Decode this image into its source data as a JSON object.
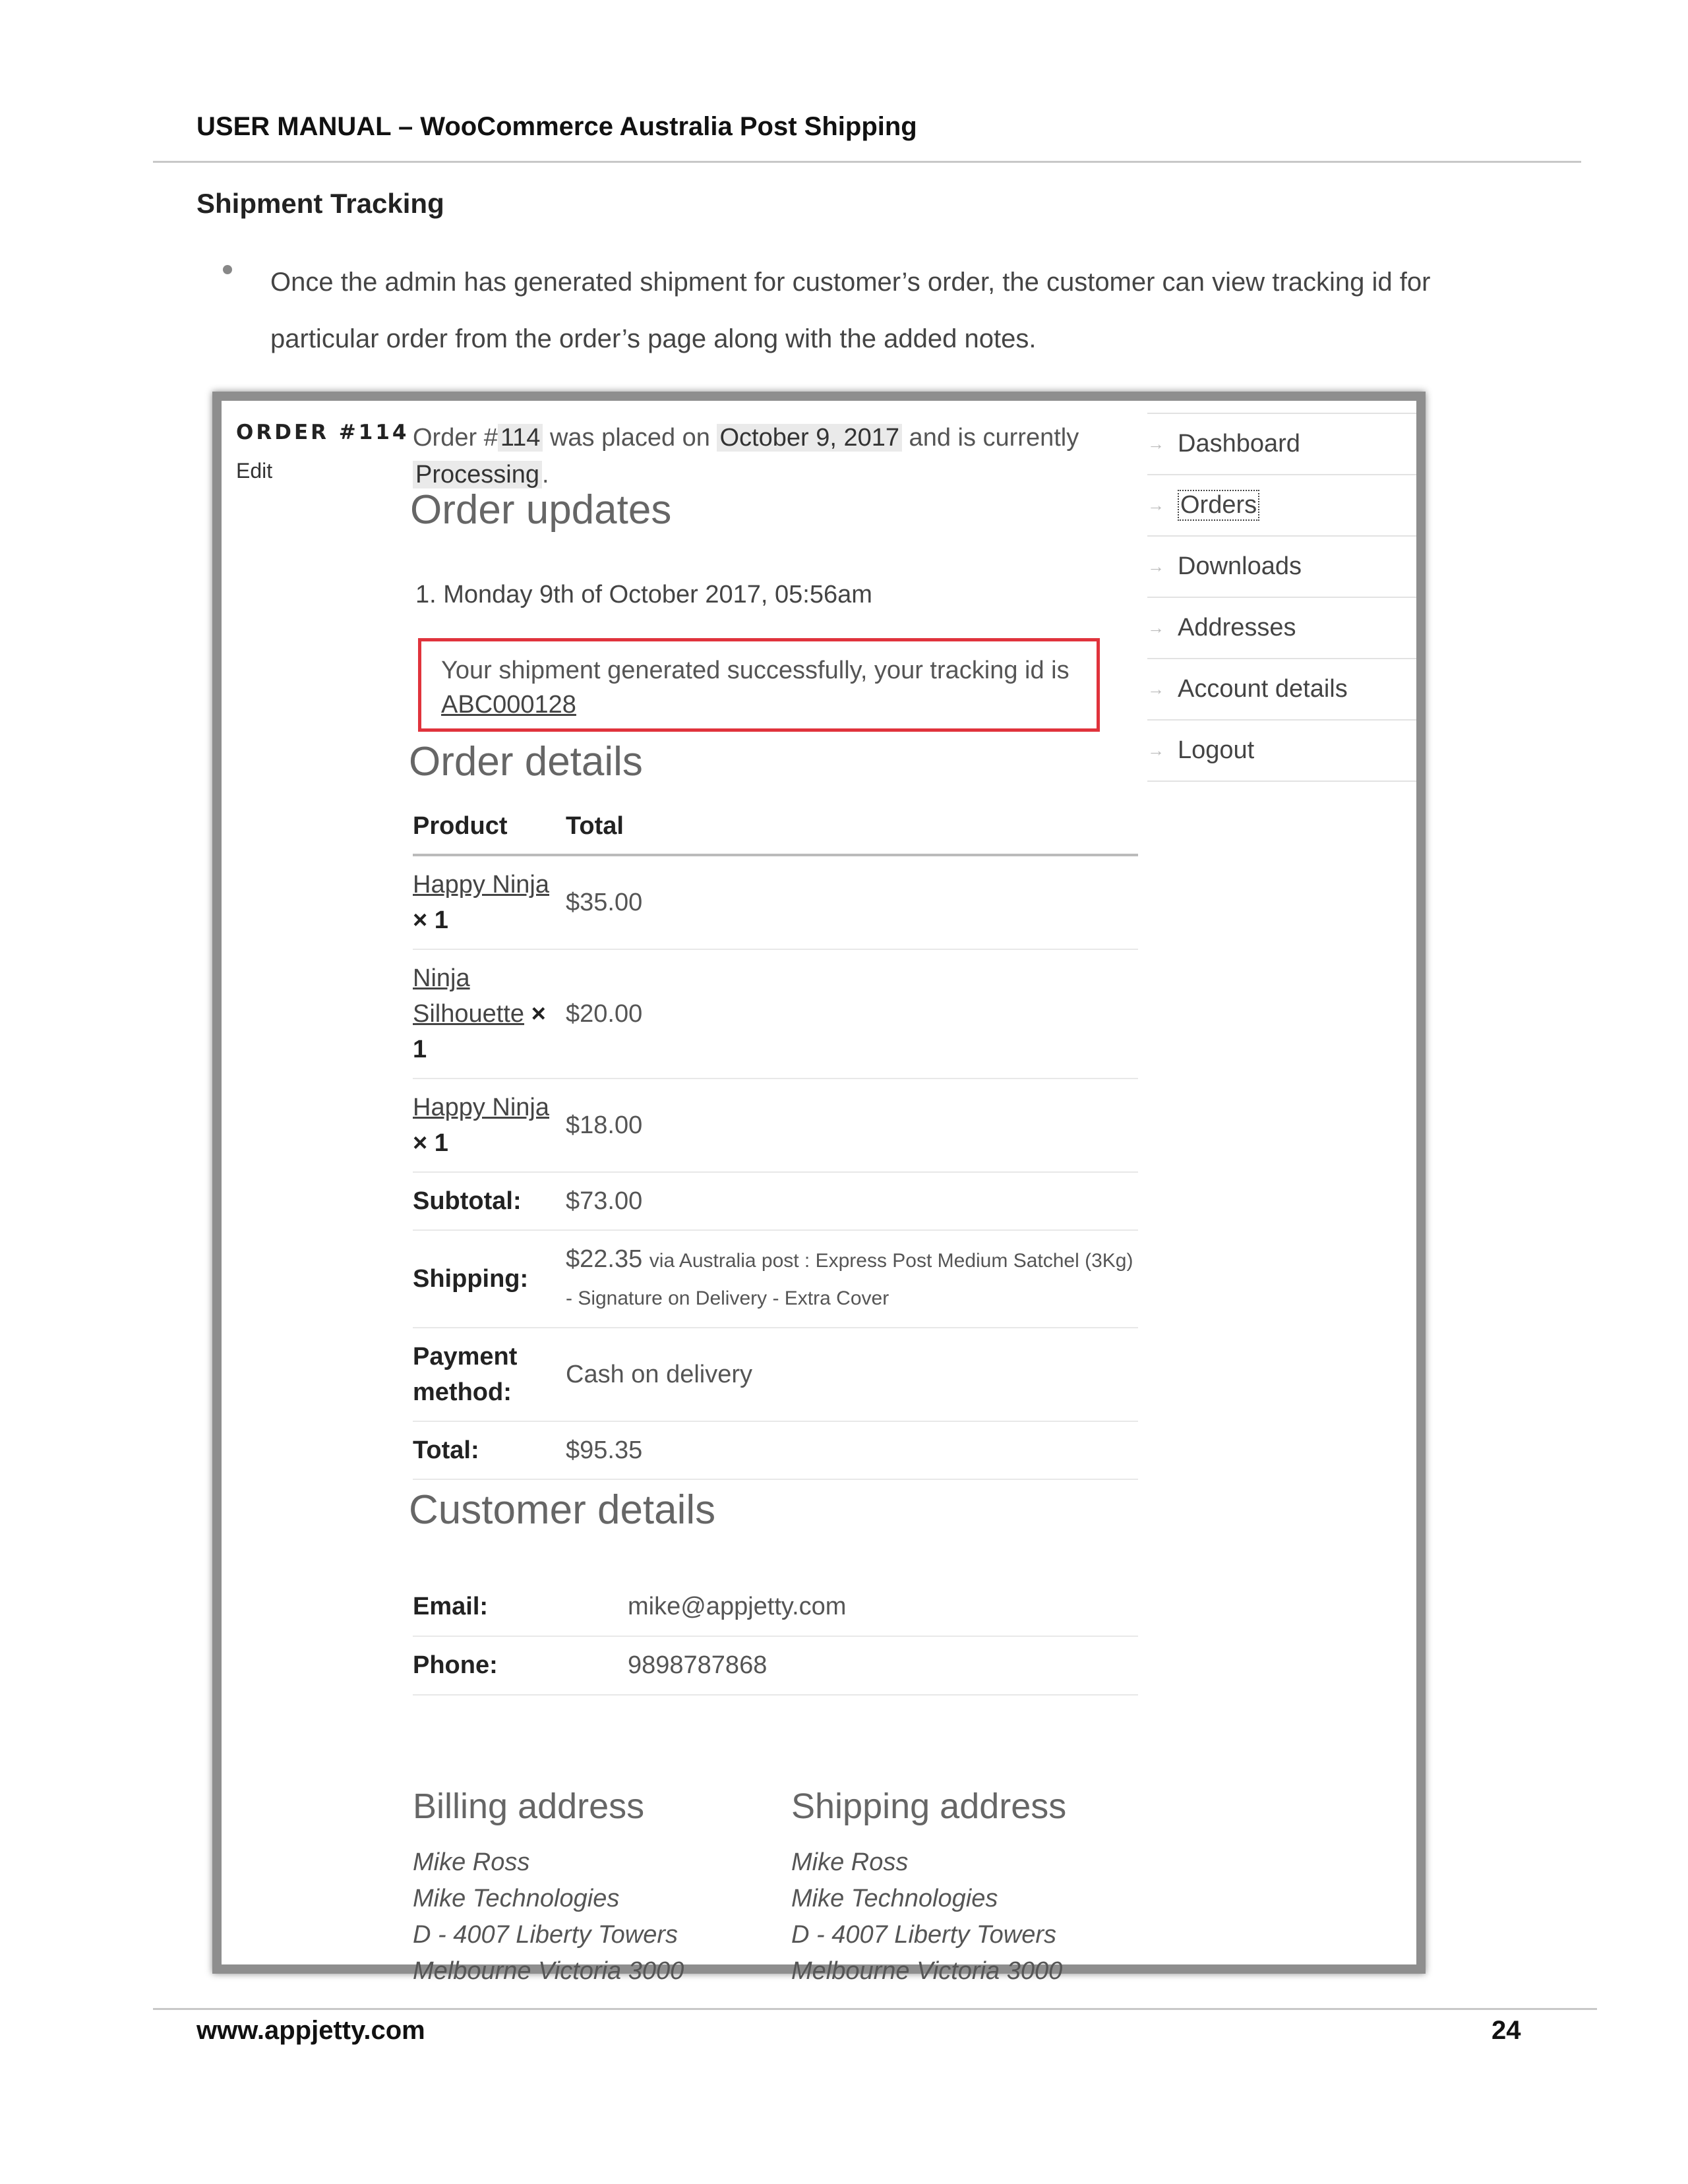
{
  "doc": {
    "header": "USER MANUAL – WooCommerce Australia Post Shipping",
    "section_title": "Shipment Tracking",
    "bullet_text": "Once the admin has generated shipment for customer’s order, the customer can view tracking id for particular order from the order’s page along with the added notes.",
    "footer_url": "www.appjetty.com",
    "page_number": "24"
  },
  "screenshot": {
    "order_label": "ORDER #114",
    "edit_label": "Edit",
    "status_line": {
      "prefix": "Order #",
      "order_number": "114",
      "mid": " was placed on ",
      "date": "October 9, 2017",
      "suffix": " and is currently ",
      "status": "Processing",
      "end": "."
    },
    "order_updates_title": "Order updates",
    "update": {
      "date": "1. Monday 9th of October 2017, 05:56am",
      "note": "Your shipment generated successfully, your tracking id is",
      "tracking_id": "ABC000128"
    },
    "order_details_title": "Order details",
    "table_headers": {
      "product": "Product",
      "total": "Total"
    },
    "products": [
      {
        "name": "Happy Ninja",
        "qty": "× 1",
        "total": "$35.00"
      },
      {
        "name": "Ninja Silhouette",
        "qty": "× 1",
        "total": "$20.00"
      },
      {
        "name": "Happy Ninja",
        "qty": "× 1",
        "total": "$18.00"
      }
    ],
    "totals": {
      "subtotal_label": "Subtotal:",
      "subtotal": "$73.00",
      "shipping_label": "Shipping:",
      "shipping_amount": "$22.35",
      "shipping_via": "via Australia post : Express Post Medium Satchel (3Kg) - Signature on Delivery - Extra Cover",
      "payment_label": "Payment method:",
      "payment": "Cash on delivery",
      "total_label": "Total:",
      "total": "$95.35"
    },
    "customer_details_title": "Customer details",
    "customer": {
      "email_label": "Email:",
      "email": "mike@appjetty.com",
      "phone_label": "Phone:",
      "phone": "9898787868"
    },
    "billing": {
      "title": "Billing address",
      "lines": [
        "Mike Ross",
        "Mike Technologies",
        "D - 4007 Liberty Towers",
        "Melbourne Victoria 3000"
      ]
    },
    "shipping": {
      "title": "Shipping address",
      "lines": [
        "Mike Ross",
        "Mike Technologies",
        "D - 4007 Liberty Towers",
        "Melbourne Victoria 3000"
      ]
    },
    "nav": [
      {
        "label": "Dashboard"
      },
      {
        "label": "Orders",
        "active": true
      },
      {
        "label": "Downloads"
      },
      {
        "label": "Addresses"
      },
      {
        "label": "Account details"
      },
      {
        "label": "Logout"
      }
    ]
  },
  "colors": {
    "note_border": "#e0333c",
    "frame": "#8e8e8e"
  }
}
